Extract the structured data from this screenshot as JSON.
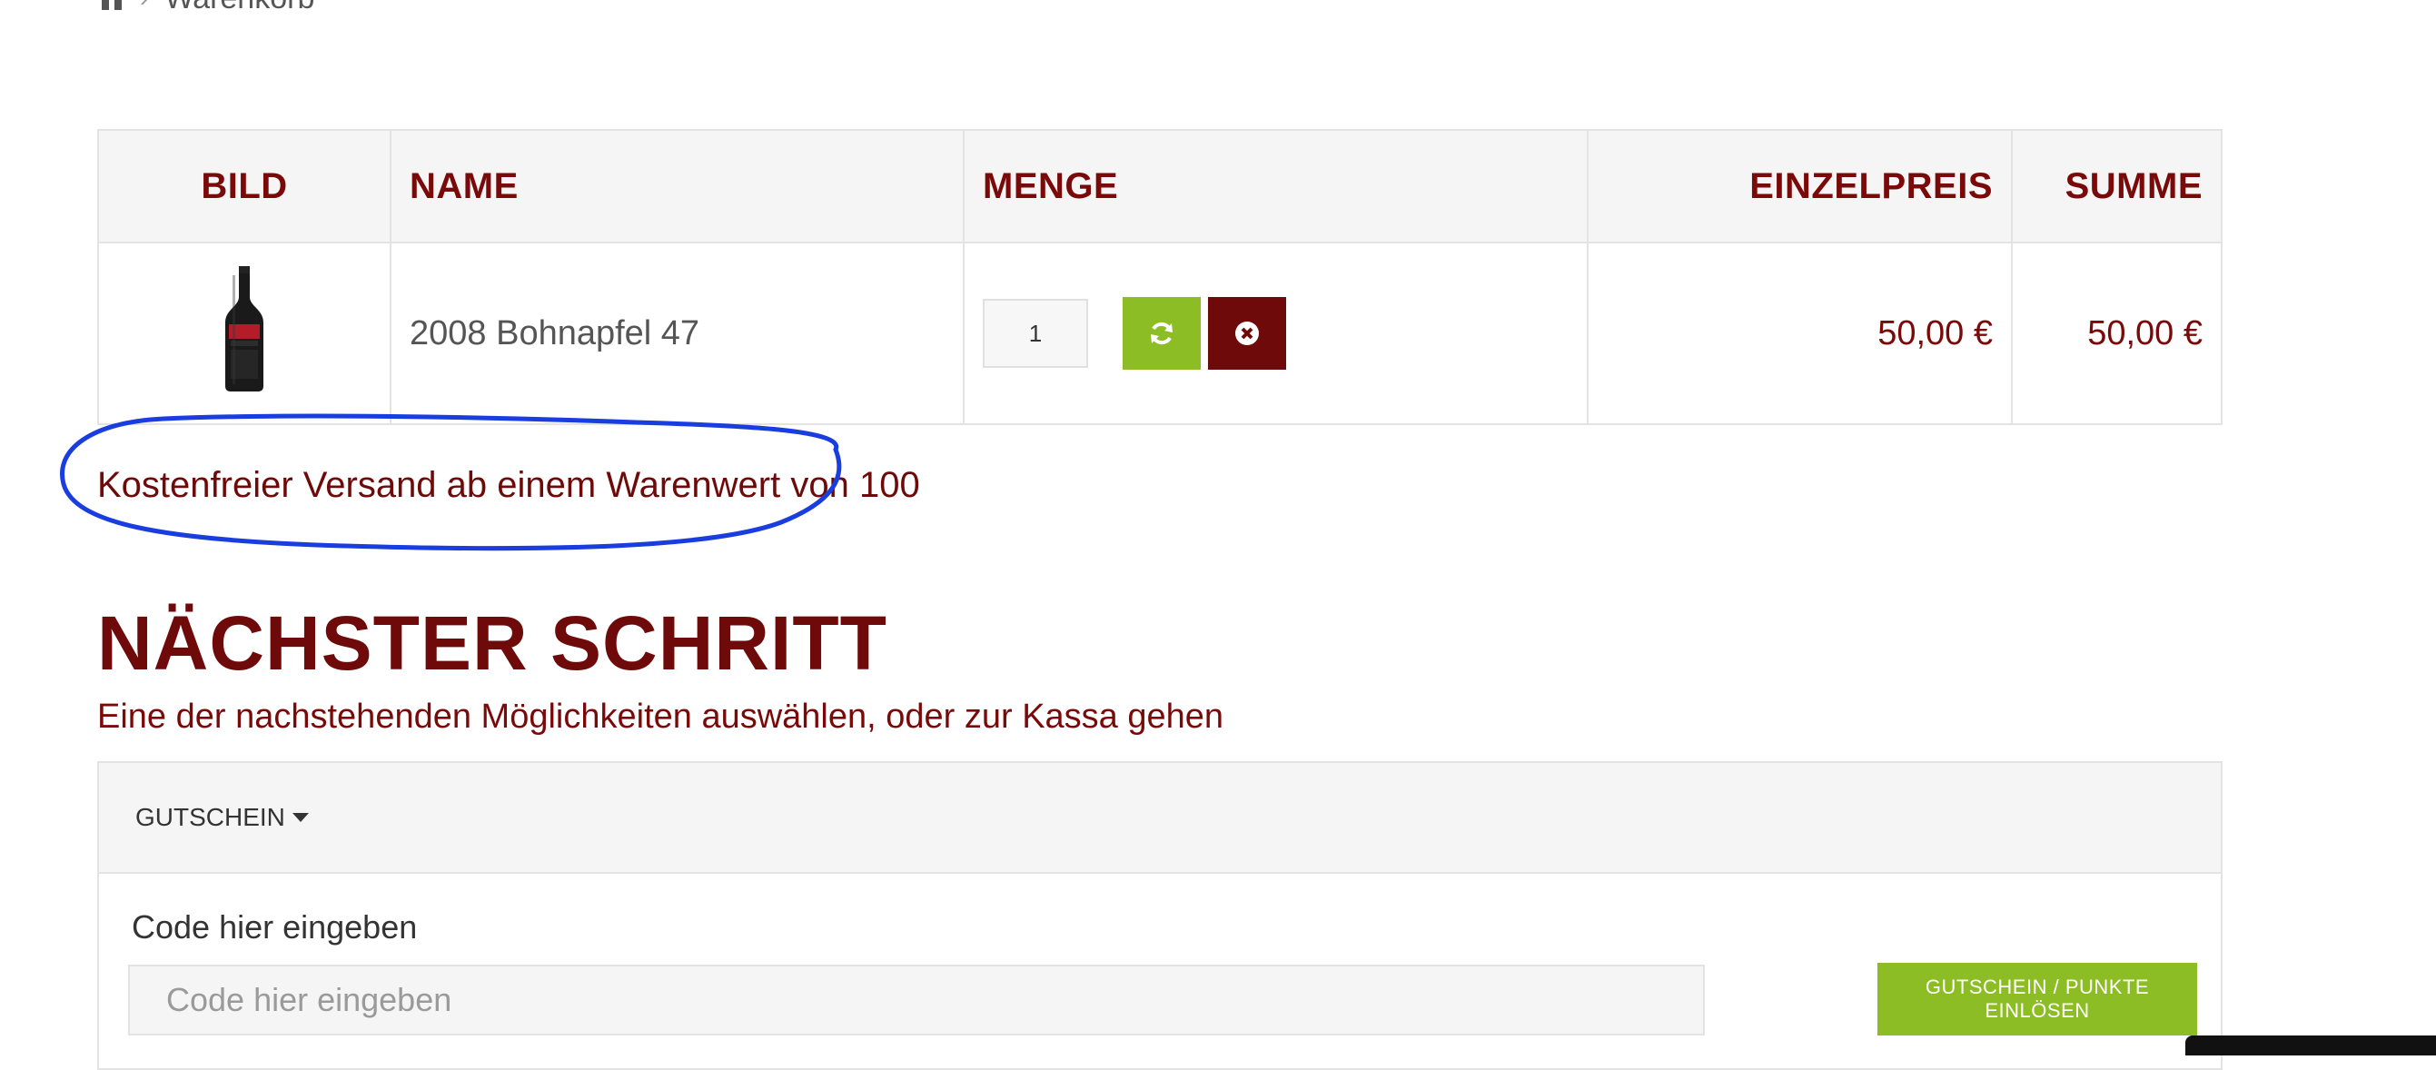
{
  "breadcrumb": {
    "home_icon": "home-icon",
    "separator": "›",
    "current": "Warenkorb"
  },
  "cart": {
    "headers": {
      "bild": "BILD",
      "name": "NAME",
      "menge": "MENGE",
      "einzelpreis": "EINZELPREIS",
      "summe": "SUMME"
    },
    "items": [
      {
        "image_icon": "wine-bottle-icon",
        "name": "2008 Bohnapfel 47",
        "quantity": "1",
        "unit_price": "50,00 €",
        "total": "50,00 €"
      }
    ],
    "refresh_icon": "refresh-icon",
    "remove_icon": "remove-icon"
  },
  "shipping_note": "Kostenfreier Versand ab einem Warenwert von 100",
  "next_step": {
    "title": "NÄCHSTER SCHRITT",
    "subtitle": "Eine der nachstehenden Möglichkeiten auswählen, oder zur Kassa gehen"
  },
  "coupon": {
    "toggle_label": "GUTSCHEIN",
    "field_label": "Code hier eingeben",
    "placeholder": "Code hier eingeben",
    "submit_label": "GUTSCHEIN / PUNKTE EINLÖSEN"
  },
  "colors": {
    "brand_red": "#6e0a0a",
    "accent_green": "#8cbd25",
    "annotation_blue": "#1a3de0"
  }
}
